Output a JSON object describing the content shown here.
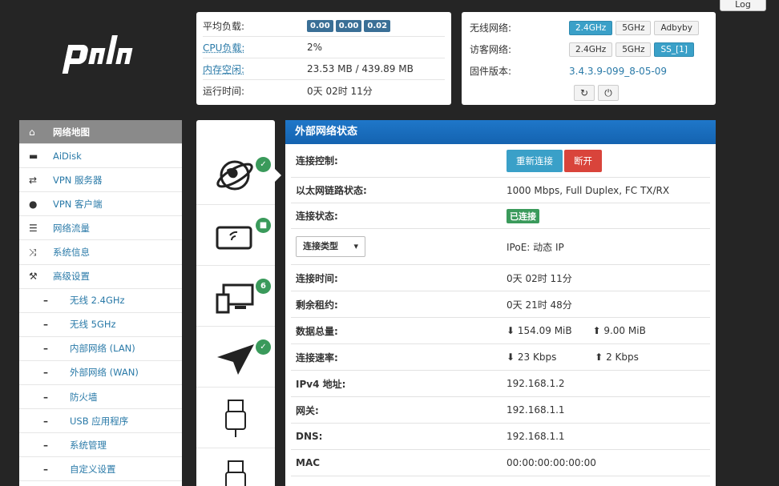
{
  "logout_label": "Log",
  "logo_text": "padavan",
  "stats": {
    "load_label": "平均负载:",
    "load_values": [
      "0.00",
      "0.00",
      "0.02"
    ],
    "cpu_label": "CPU负载:",
    "cpu_value": "2%",
    "mem_label": "内存空闲:",
    "mem_value": "23.53 MB / 439.89 MB",
    "uptime_label": "运行时间:",
    "uptime_value": "0天 02时 11分"
  },
  "network": {
    "wireless_label": "无线网络:",
    "wireless_buttons": [
      "2.4GHz",
      "5GHz",
      "Adbyby"
    ],
    "guest_label": "访客网络:",
    "guest_buttons": [
      "2.4GHz",
      "5GHz",
      "SS_[1]"
    ],
    "firmware_label": "固件版本:",
    "firmware_value": "3.4.3.9-099_8-05-09"
  },
  "sidebar": {
    "items": [
      {
        "label": "网络地图",
        "icon": "home-icon"
      },
      {
        "label": "AiDisk",
        "icon": "disk-icon"
      },
      {
        "label": "VPN 服务器",
        "icon": "swap-icon"
      },
      {
        "label": "VPN 客户端",
        "icon": "globe-icon"
      },
      {
        "label": "网络流量",
        "icon": "list-icon"
      },
      {
        "label": "系统信息",
        "icon": "shuffle-icon"
      },
      {
        "label": "高级设置",
        "icon": "wrench-icon"
      }
    ],
    "sub_items": [
      "无线 2.4GHz",
      "无线 5GHz",
      "内部网络 (LAN)",
      "外部网络 (WAN)",
      "防火墙",
      "USB 应用程序",
      "系统管理",
      "自定义设置"
    ]
  },
  "devices": {
    "clients_count": "6"
  },
  "main": {
    "title": "外部网络状态",
    "rows": {
      "conn_ctrl_label": "连接控制:",
      "reconnect_label": "重新连接",
      "disconnect_label": "断开",
      "eth_label": "以太网链路状态:",
      "eth_value": "1000 Mbps, Full Duplex, FC TX/RX",
      "conn_status_label": "连接状态:",
      "conn_status_value": "已连接",
      "conn_type_select": "连接类型",
      "conn_type_value": "IPoE: 动态 IP",
      "conn_time_label": "连接时间:",
      "conn_time_value": "0天 02时 11分",
      "lease_label": "剩余租约:",
      "lease_value": "0天 21时 48分",
      "data_label": "数据总量:",
      "data_down": "154.09 MiB",
      "data_up": "9.00 MiB",
      "speed_label": "连接速率:",
      "speed_down": "23 Kbps",
      "speed_up": "2 Kbps",
      "ipv4_label": "IPv4 地址:",
      "ipv4_value": "192.168.1.2",
      "gateway_label": "网关:",
      "gateway_value": "192.168.1.1",
      "dns_label": "DNS:",
      "dns_value": "192.168.1.1",
      "mac_label": "MAC",
      "mac_value": "00:00:00:00:00:00"
    }
  }
}
